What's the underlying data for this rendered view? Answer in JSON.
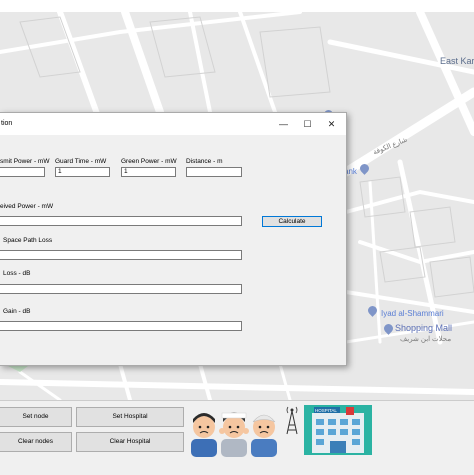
{
  "map": {
    "labels": {
      "east_karrada": "East Karra",
      "street_arabic": "شارع الكوفة",
      "bank": "ank",
      "iyad": "Iyad al-Shammari",
      "mall": "Shopping Mall",
      "mall_arabic": "محلات ابن شريف"
    }
  },
  "dialog": {
    "title": "tion",
    "labels": {
      "transmit_power": "smit Power - mW",
      "guard_time": "Guard Time - mW",
      "green_power": "Green Power - mW",
      "distance": "Distance - m",
      "received_power": "eived Power - mW",
      "free_space": "Space Path Loss",
      "loss": "Loss - dB",
      "gain": "Gain - dB"
    },
    "values": {
      "transmit_power": "",
      "guard_time": "1",
      "green_power": "1",
      "distance": "",
      "received_power": "",
      "free_space": "",
      "loss": "",
      "gain": ""
    },
    "calculate_label": "Calculate",
    "minimize": "—",
    "maximize": "☐",
    "close": "✕"
  },
  "bottom": {
    "set_node": "Set node",
    "set_hospital": "Set Hospital",
    "clear_nodes": "Clear nodes",
    "clear_hospital": "Clear Hospital",
    "hospital_sign": "HOSPITAL"
  }
}
